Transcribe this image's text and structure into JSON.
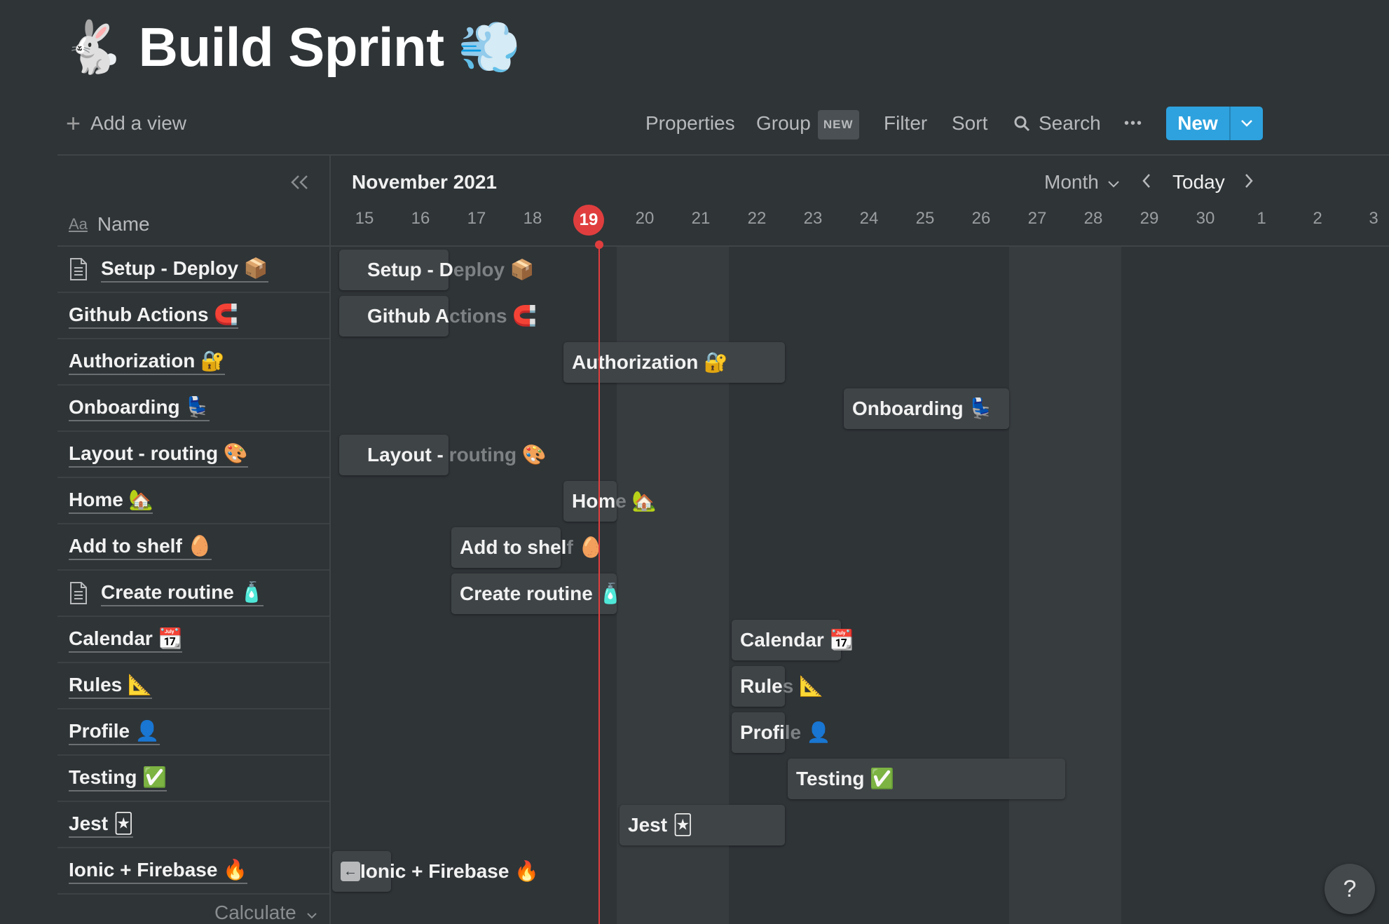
{
  "page": {
    "icon_left": "🐇",
    "title": "Build Sprint",
    "icon_right": "💨"
  },
  "toolbar": {
    "add_view": "Add a view",
    "properties": "Properties",
    "group": "Group",
    "group_badge": "NEW",
    "filter": "Filter",
    "sort": "Sort",
    "search": "Search",
    "more": "•••",
    "new": "New"
  },
  "table": {
    "name_header": "Name",
    "name_header_icon": "Aa",
    "calculate": "Calculate",
    "rows": [
      {
        "name": "Setup - Deploy 📦",
        "has_doc_icon": true
      },
      {
        "name": "Github Actions 🧲",
        "has_doc_icon": false
      },
      {
        "name": "Authorization 🔐",
        "has_doc_icon": false
      },
      {
        "name": "Onboarding 💺",
        "has_doc_icon": false
      },
      {
        "name": "Layout - routing 🎨",
        "has_doc_icon": false
      },
      {
        "name": "Home 🏡",
        "has_doc_icon": false
      },
      {
        "name": "Add to shelf 🥚",
        "has_doc_icon": false
      },
      {
        "name": "Create routine 🧴",
        "has_doc_icon": true
      },
      {
        "name": "Calendar 📆",
        "has_doc_icon": false
      },
      {
        "name": "Rules 📐",
        "has_doc_icon": false
      },
      {
        "name": "Profile 👤",
        "has_doc_icon": false
      },
      {
        "name": "Testing ✅",
        "has_doc_icon": false
      },
      {
        "name": "Jest 🃏",
        "has_doc_icon": false
      },
      {
        "name": "Ionic + Firebase 🔥",
        "has_doc_icon": false
      }
    ]
  },
  "timeline": {
    "month_label": "November 2021",
    "scale_label": "Month",
    "today_label": "Today",
    "today_day": "19",
    "days": [
      "15",
      "16",
      "17",
      "18",
      "19",
      "20",
      "21",
      "22",
      "23",
      "24",
      "25",
      "26",
      "27",
      "28",
      "29",
      "30",
      "1",
      "2",
      "3"
    ],
    "bars": [
      {
        "label_visible": "Setup - D",
        "label_faded": "eploy 📦",
        "start": 0,
        "span": 2
      },
      {
        "label_visible": "Github A",
        "label_faded": "ctions 🧲",
        "start": 0,
        "span": 2
      },
      {
        "label_visible": "Authorization 🔐",
        "label_faded": "",
        "start": 4,
        "span": 4
      },
      {
        "label_visible": "Onboarding 💺",
        "label_faded": "",
        "start": 9,
        "span": 3
      },
      {
        "label_visible": "Layout - ",
        "label_faded": "routing 🎨",
        "start": 0,
        "span": 2
      },
      {
        "label_visible": "Hom",
        "label_faded": "e 🏡",
        "start": 4,
        "span": 1
      },
      {
        "label_visible": "Add to shel",
        "label_faded": "f 🥚",
        "start": 2,
        "span": 2
      },
      {
        "label_visible": "Create routine 🧴",
        "label_faded": "",
        "start": 2,
        "span": 3
      },
      {
        "label_visible": "Calendar 📆",
        "label_faded": "",
        "start": 7,
        "span": 2
      },
      {
        "label_visible": "Rule",
        "label_faded": "s 📐",
        "start": 7,
        "span": 1
      },
      {
        "label_visible": "Profi",
        "label_faded": "le 👤",
        "start": 7,
        "span": 1
      },
      {
        "label_visible": "Testing ✅",
        "label_faded": "",
        "start": 8,
        "span": 5
      },
      {
        "label_visible": "Jest 🃏",
        "label_faded": "",
        "start": 5,
        "span": 3
      },
      {
        "label_visible": "Ionic + Firebase 🔥",
        "label_faded": "",
        "start": -1,
        "span": 2,
        "offscreen_left": true
      }
    ]
  },
  "help": "?",
  "colors": {
    "background": "#2f3437",
    "accent": "#2ea2de",
    "today": "#e03e3e"
  }
}
